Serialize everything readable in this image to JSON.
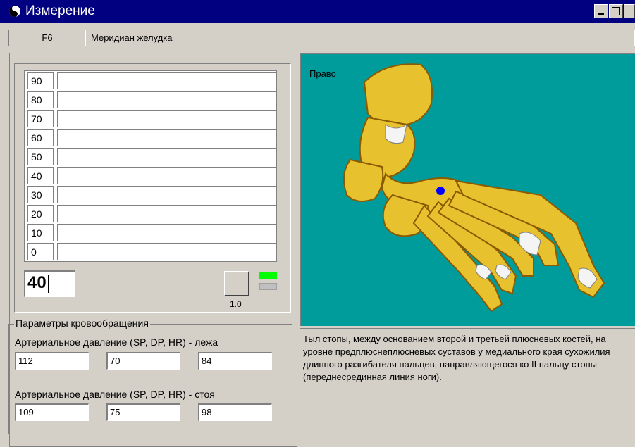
{
  "window": {
    "title": "Измерение"
  },
  "point": {
    "code": "F6",
    "meridian": "Меридиан желудка"
  },
  "scale": {
    "labels": [
      "90",
      "80",
      "70",
      "60",
      "50",
      "40",
      "30",
      "20",
      "10",
      "0"
    ],
    "current_value": "40",
    "gain": "1.0"
  },
  "circulation": {
    "title": "Параметры кровообращения",
    "lying": {
      "label": "Артериальное давление (SP, DP, HR) - лежа",
      "sp": "112",
      "dp": "70",
      "hr": "84"
    },
    "standing": {
      "label": "Артериальное давление (SP, DP, HR) - стоя",
      "sp": "109",
      "dp": "75",
      "hr": "98"
    }
  },
  "image": {
    "side_label": "Право"
  },
  "description": "Тыл стопы, между основанием второй и третьей плюсневых костей, на уровне предплюснеплюсневых суставов у медиального края сухожилия длинного разгибателя пальцев, направляющегося ко II пальцу стопы (переднесрединная линия ноги).",
  "colors": {
    "titlebar": "#000080",
    "image_bg": "#009c9c",
    "bone": "#e8c12f",
    "marker": "#0000ff",
    "led_on": "#00ff00",
    "led_off": "#c0c0c0"
  },
  "icons": [
    "app-icon",
    "minimize-icon",
    "maximize-icon",
    "close-icon"
  ]
}
